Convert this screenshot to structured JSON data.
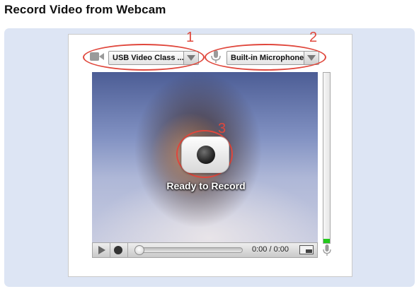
{
  "page": {
    "title": "Record Video from Webcam"
  },
  "devices": {
    "camera": {
      "selected": "USB Video Class ...",
      "icon": "video-camera-icon"
    },
    "microphone": {
      "selected": "Built-in Microphone",
      "icon": "microphone-icon"
    }
  },
  "callouts": {
    "one": "1",
    "two": "2",
    "three": "3"
  },
  "preview": {
    "status": "Ready to Record",
    "record_icon": "record-icon"
  },
  "player": {
    "time": "0:00 / 0:00",
    "play_icon": "play-icon",
    "record_icon": "record-small-icon",
    "pip_icon": "picture-in-picture-icon",
    "seek_position": 0
  },
  "audio_meter": {
    "level": 0.025,
    "icon": "microphone-icon",
    "fill_color": "#23c81c"
  },
  "colors": {
    "accent": "#e0473c",
    "panel": "#dde5f4"
  }
}
